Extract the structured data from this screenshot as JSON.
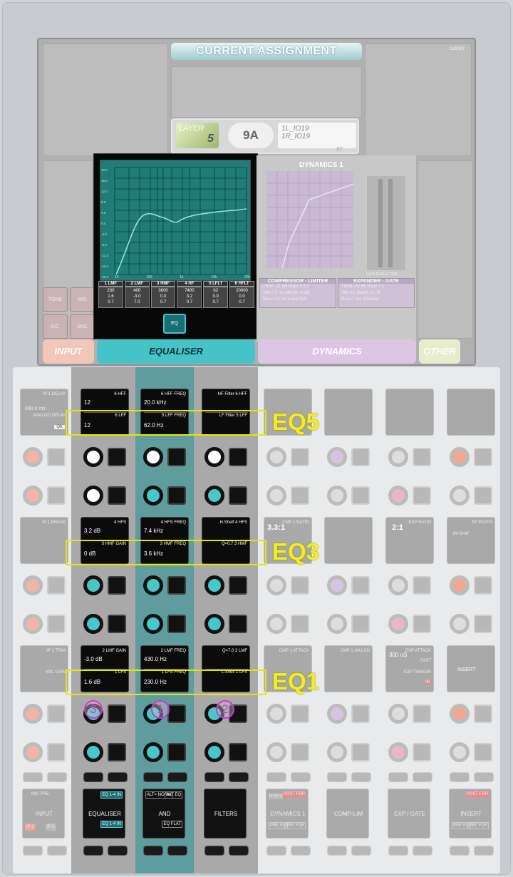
{
  "header": {
    "title": "CURRENT ASSIGNMENT",
    "logo_text": "calrec"
  },
  "assignment": {
    "layer_label": "LAYER",
    "layer_num": "5",
    "fader": "9A",
    "path_line1": "1L_IO19",
    "path_line2": "1R_IO19",
    "path_type": "ST"
  },
  "left_buttons": [
    {
      "label": "TONE"
    },
    {
      "label": "M/S"
    },
    {
      "label": "A/C"
    },
    {
      "label": "SRC"
    }
  ],
  "eq_graph": {
    "y_ticks": [
      "20.0",
      "16.0",
      "12.0",
      "8.0",
      "4.0",
      "0.0",
      "-4.0",
      "-8.0",
      "-12.0",
      "-16.0",
      "-20.0"
    ],
    "x_ticks": [
      "10",
      "100",
      "1k",
      "10k",
      "20k"
    ]
  },
  "eq_bands": [
    {
      "name": "1 LMF",
      "freq": "230",
      "unit": "Hz",
      "gain": "1.6",
      "q": "0.7"
    },
    {
      "name": "2 LMF",
      "freq": "400",
      "unit": "Hz",
      "gain": "-3.0",
      "q": "7.0"
    },
    {
      "name": "3 HMF",
      "freq": "3600",
      "unit": "Hz",
      "gain": "0.0",
      "q": "0.7"
    },
    {
      "name": "4 HF",
      "freq": "7400",
      "unit": "Hz",
      "gain": "3.2",
      "q": "0.7"
    },
    {
      "name": "5 LFLT",
      "freq": "62",
      "unit": "Hz",
      "gain": "0.0",
      "q": "0.7"
    },
    {
      "name": "6 HFLT",
      "freq": "20000",
      "unit": "Hz",
      "gain": "0.0",
      "q": "0.7"
    }
  ],
  "eq_button": "EQ",
  "dynamics": {
    "title": "DYNAMICS 1",
    "comp_title": "COMPRESSOR - LIMITER",
    "exp_title": "EXPANDER - GATE",
    "gain_reduction": "GAIN REDUCTION",
    "comp_lines": [
      "Thrsh -11 dB  Ratio 3.3:1",
      "Attk 0.5 ms  Mk/Gn +t dB",
      "Recv 0.0 ms  Knee Soft"
    ],
    "exp_lines": [
      "Thrsh -20 dB  Ratio 2:1",
      "Attk   ms   Depth 10 dB",
      "Recv 7 ms  Xtended"
    ]
  },
  "tabs": [
    {
      "label": "INPUT",
      "color": "#f2c7b8"
    },
    {
      "label": "EQUALISER",
      "color": "#45c3c6"
    },
    {
      "label": "DYNAMICS",
      "color": "#ddc6e3"
    },
    {
      "label": "OTHER",
      "color": "#e7ecca"
    }
  ],
  "eq_labels": [
    "EQ5",
    "EQ3",
    "EQ1"
  ],
  "col1": {
    "top_lines": [
      "6 HFF",
      "6 LFF"
    ],
    "top_vals": [
      "12",
      "12"
    ],
    "mid_lines": [
      "4 HFS",
      "3 HMF GAIN"
    ],
    "mid_vals": [
      "3.2 dB",
      "0 dB"
    ],
    "bot_lines": [
      "2 LMF GAIN",
      "1 LFS"
    ],
    "bot_vals": [
      "-3.0 dB",
      "1.6 dB"
    ],
    "num": "3",
    "bottom_btn": "EQUALISER",
    "bottom_sub1": "EQ 1-4 IN",
    "bottom_sub2": "EQ 1-4 IN"
  },
  "col2": {
    "top_lines": [
      "6 HFF FREQ",
      "5 LFF FREQ"
    ],
    "top_vals": [
      "20.0 kHz",
      "62.0 Hz"
    ],
    "mid_lines": [
      "4 HFS FREQ",
      "3 HMF FREQ"
    ],
    "mid_vals": [
      "7.4 kHz",
      "3.6 kHz"
    ],
    "bot_lines": [
      "2 LMF FREQ",
      "1 LFS FREQ"
    ],
    "bot_vals": [
      "430.0 Hz",
      "230.0 Hz"
    ],
    "num": "1",
    "bottom_btn": "AND",
    "bottom_sub1": "ALT= NORM",
    "bottom_sub2": "ALT EQ",
    "bottom_sub3": "EQ FLAT"
  },
  "col3": {
    "top_lines": [
      "HF Filter 6 HFF",
      "LF Filter 5 LFF"
    ],
    "mid_lines": [
      "H.Shelf 4 HFS",
      "Q=0.7 3 HMF"
    ],
    "bot_lines": [
      "Q=7.0 2 LMF",
      "L.Shelf 1 LFS"
    ],
    "num": "2",
    "bottom_btn": "FILTERS"
  },
  "input_col": {
    "top_lines": [
      "IP 1 DELAY",
      "ANALOG DELAY",
      "OK"
    ],
    "top_val": "480.0 ms",
    "mid_lines": [
      "IP 1 PHASE"
    ],
    "bot_lines": [
      "IP 1 TRIM",
      "MIC GAIN"
    ],
    "bottom_btn": "INPUT",
    "bottom_sub": "MIC PRE",
    "ip1": "IP 1",
    "ip2": "IP 2"
  },
  "dyn_cols": {
    "mid_vals": [
      "3.3:1",
      "2:1"
    ],
    "mid_labels": [
      "CMP 1 RATIO",
      "EXP RATIO"
    ],
    "bot_vals": [
      "300 uS"
    ],
    "bot_labels": [
      "CMP 1 ATTACK",
      "CMP 1 M/U GN",
      "EXP ATTACK",
      "FAST",
      "EXP THRESH",
      "IN"
    ],
    "mid_other": [
      "ST WIDTH",
      "M=S=W"
    ],
    "insert_label": "INSERT",
    "bottoms": [
      {
        "label": "DYNAMICS 1",
        "sub": "DYN 2",
        "sub2": "POST FDR",
        "sub3": "PRE EQ",
        "sub4": "PRE FDR"
      },
      {
        "label": "COMP-LIM"
      },
      {
        "label": "EXP / GATE"
      },
      {
        "label": "INSERT",
        "sub2": "POST FDR",
        "sub3": "PRE EQ",
        "sub4": "PRE FDR"
      }
    ]
  }
}
